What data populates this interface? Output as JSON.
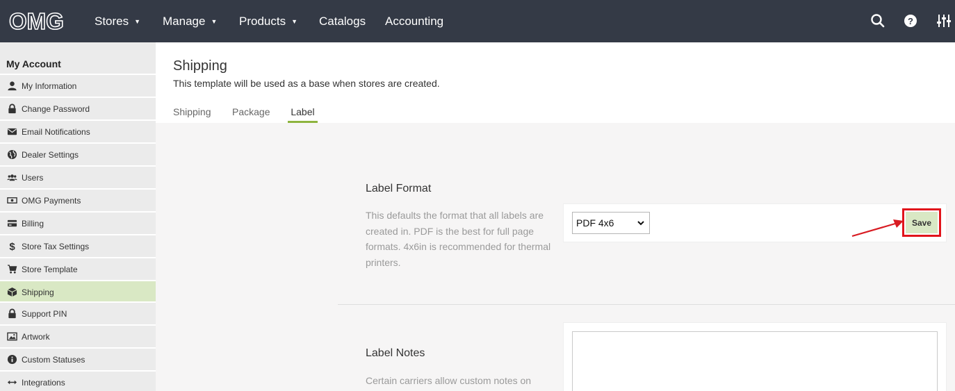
{
  "app": {
    "logo_text": "OMG"
  },
  "nav": {
    "items": [
      {
        "label": "Stores",
        "caret": "▼"
      },
      {
        "label": "Manage",
        "caret": "▼"
      },
      {
        "label": "Products",
        "caret": "▼"
      },
      {
        "label": "Catalogs"
      },
      {
        "label": "Accounting"
      }
    ],
    "icons": [
      "search-icon",
      "help-icon",
      "settings-sliders-icon"
    ]
  },
  "sidebar": {
    "heading": "My Account",
    "items": [
      {
        "label": "My Information",
        "icon": "user-icon"
      },
      {
        "label": "Change Password",
        "icon": "lock-icon"
      },
      {
        "label": "Email Notifications",
        "icon": "envelope-icon"
      },
      {
        "label": "Dealer Settings",
        "icon": "globe-icon"
      },
      {
        "label": "Users",
        "icon": "users-icon"
      },
      {
        "label": "OMG Payments",
        "icon": "money-icon"
      },
      {
        "label": "Billing",
        "icon": "credit-card-icon"
      },
      {
        "label": "Store Tax Settings",
        "icon": "dollar-icon"
      },
      {
        "label": "Store Template",
        "icon": "cart-icon"
      },
      {
        "label": "Shipping",
        "icon": "box-icon",
        "active": true
      },
      {
        "label": "Support PIN",
        "icon": "lock-icon"
      },
      {
        "label": "Artwork",
        "icon": "image-icon"
      },
      {
        "label": "Custom Statuses",
        "icon": "info-icon"
      },
      {
        "label": "Integrations",
        "icon": "arrows-horizontal-icon"
      }
    ]
  },
  "header": {
    "title": "Shipping",
    "subtitle": "This template will be used as a base when stores are created."
  },
  "tabs": [
    {
      "label": "Shipping"
    },
    {
      "label": "Package"
    },
    {
      "label": "Label",
      "active": true
    }
  ],
  "label_format": {
    "title": "Label Format",
    "description": "This defaults the format that all labels are created in. PDF is the best for full page formats. 4x6in is recommended for thermal printers.",
    "selected": "PDF 4x6",
    "save_label": "Save",
    "highlight_color": "#e1141b"
  },
  "label_notes": {
    "title": "Label Notes",
    "description": "Certain carriers allow custom notes on"
  },
  "colors": {
    "nav_bg": "#343a46",
    "accent": "#8db43e",
    "active_bg": "#d9e8c4"
  }
}
